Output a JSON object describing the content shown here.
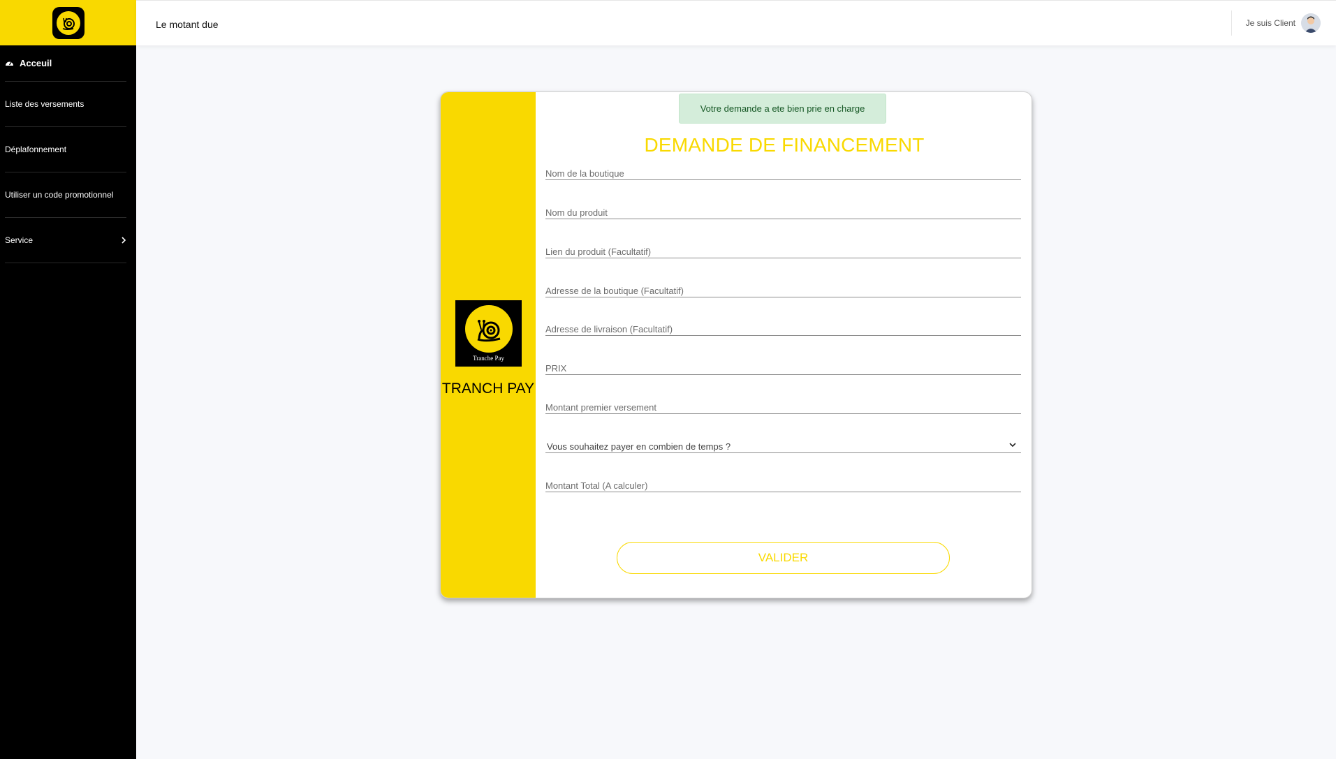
{
  "topbar": {
    "title": "Le motant due",
    "user_label": "Je suis Client"
  },
  "sidebar": {
    "items": [
      {
        "label": "Acceuil",
        "icon": "dashboard-icon",
        "active": true
      },
      {
        "label": "Liste des versements"
      },
      {
        "label": "Déplafonnement"
      },
      {
        "label": "Utiliser un code promotionnel"
      },
      {
        "label": "Service",
        "icon": "chevron-right-icon"
      }
    ]
  },
  "card": {
    "brand": "TRANCH PAY",
    "logo_caption": "Tranche Pay",
    "alert": "Votre demande a ete bien prie en charge",
    "title": "DEMANDE DE FINANCEMENT",
    "fields": [
      {
        "label": "Nom de la boutique"
      },
      {
        "label": "Nom du produit"
      },
      {
        "label": "Lien du produit (Facultatif)"
      },
      {
        "label": "Adresse de la boutique (Facultatif)"
      },
      {
        "label": "Adresse de livraison (Facultatif)"
      },
      {
        "label": "PRIX"
      },
      {
        "label": "Montant premier versement"
      },
      {
        "label": "Vous souhaitez payer en combien de temps ?"
      },
      {
        "label": "Montant Total (A calculer)"
      }
    ],
    "submit_label": "VALIDER"
  },
  "colors": {
    "brand_yellow": "#f9d900",
    "sidebar_bg": "#000000",
    "alert_bg": "#d4edda",
    "alert_text": "#155724"
  }
}
